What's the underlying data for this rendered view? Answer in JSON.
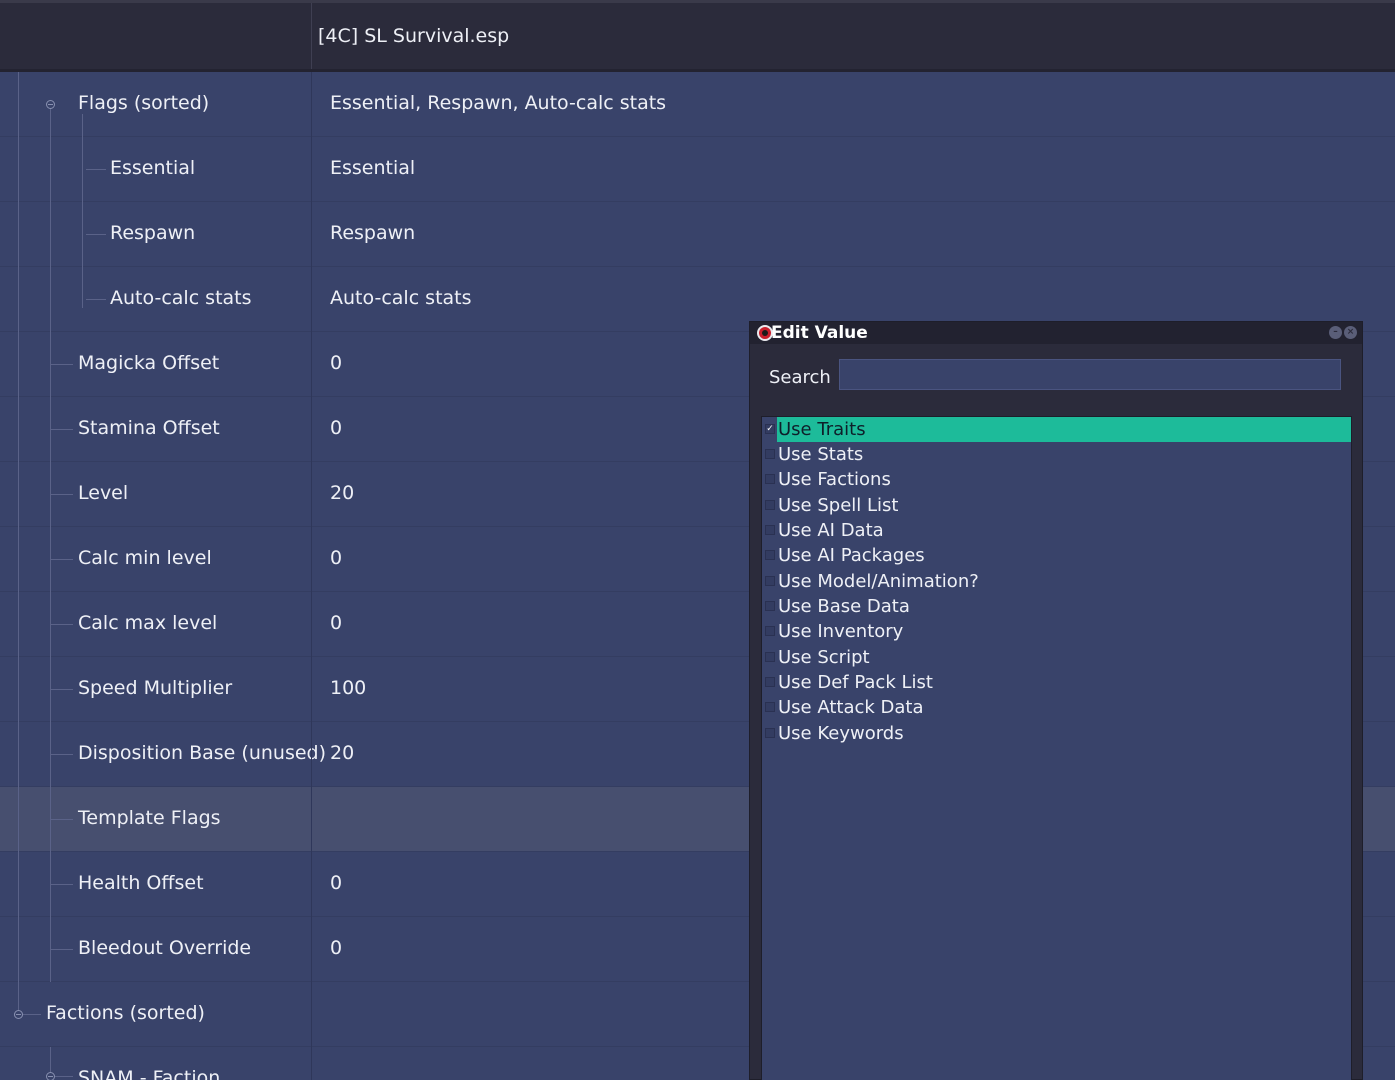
{
  "header": {
    "title": "[4C] SL Survival.esp"
  },
  "tree": {
    "rows": [
      {
        "name": "Flags (sorted)",
        "value": "Essential, Respawn, Auto-calc stats"
      },
      {
        "name": "Essential",
        "value": "Essential"
      },
      {
        "name": "Respawn",
        "value": "Respawn"
      },
      {
        "name": "Auto-calc stats",
        "value": "Auto-calc stats"
      },
      {
        "name": "Magicka Offset",
        "value": "0"
      },
      {
        "name": "Stamina Offset",
        "value": "0"
      },
      {
        "name": "Level",
        "value": "20"
      },
      {
        "name": "Calc min level",
        "value": "0"
      },
      {
        "name": "Calc max level",
        "value": "0"
      },
      {
        "name": "Speed Multiplier",
        "value": "100"
      },
      {
        "name": "Disposition Base (unused)",
        "value": "20"
      },
      {
        "name": "Template Flags",
        "value": ""
      },
      {
        "name": "Health Offset",
        "value": "0"
      },
      {
        "name": "Bleedout Override",
        "value": "0"
      },
      {
        "name": "Factions (sorted)",
        "value": ""
      },
      {
        "name": "SNAM - Faction",
        "value": ""
      }
    ]
  },
  "dialog": {
    "title": "Edit Value",
    "search_label": "Search",
    "search_value": "",
    "check_mark": "✓",
    "items": [
      {
        "label": "Use Traits",
        "checked": true
      },
      {
        "label": "Use Stats",
        "checked": false
      },
      {
        "label": "Use Factions",
        "checked": false
      },
      {
        "label": "Use Spell List",
        "checked": false
      },
      {
        "label": "Use AI Data",
        "checked": false
      },
      {
        "label": "Use AI Packages",
        "checked": false
      },
      {
        "label": "Use Model/Animation?",
        "checked": false
      },
      {
        "label": "Use Base Data",
        "checked": false
      },
      {
        "label": "Use Inventory",
        "checked": false
      },
      {
        "label": "Use Script",
        "checked": false
      },
      {
        "label": "Use Def Pack List",
        "checked": false
      },
      {
        "label": "Use Attack Data",
        "checked": false
      },
      {
        "label": "Use Keywords",
        "checked": false
      }
    ]
  },
  "colors": {
    "highlight": "#1dbb9a",
    "background": "#39436a",
    "chrome": "#2b2b3b"
  },
  "icons": [
    "app-icon",
    "minimize-icon",
    "close-icon",
    "collapse-icon"
  ]
}
